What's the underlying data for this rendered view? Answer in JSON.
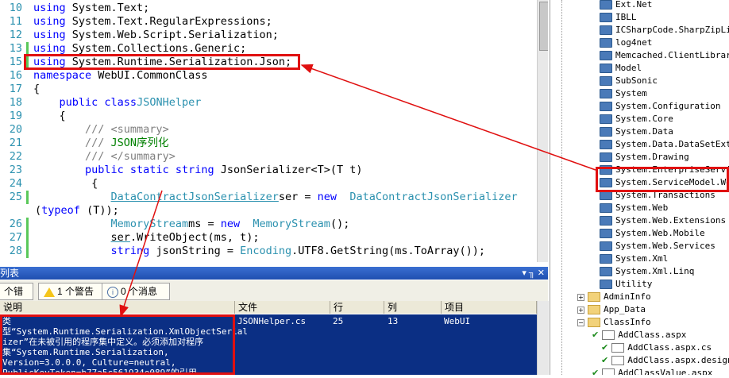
{
  "editor": {
    "lines": [
      {
        "n": "10",
        "parts": [
          [
            "kw",
            "using"
          ],
          [
            "",
            "System.Text;"
          ]
        ]
      },
      {
        "n": "11",
        "parts": [
          [
            "kw",
            "using"
          ],
          [
            "",
            "System.Text.RegularExpressions;"
          ]
        ]
      },
      {
        "n": "12",
        "parts": [
          [
            "kw",
            "using"
          ],
          [
            "",
            "System.Web.Script.Serialization;"
          ]
        ]
      },
      {
        "n": "13",
        "parts": [
          [
            "kw",
            "using"
          ],
          [
            "",
            "System.Collections.Generic;"
          ]
        ]
      },
      {
        "n": "15",
        "parts": [
          [
            "kw",
            "using"
          ],
          [
            "",
            "System.Runtime.Serialization.Json;"
          ]
        ]
      },
      {
        "n": "16",
        "parts": [
          [
            "kw",
            "namespace"
          ],
          [
            "",
            "WebUI.CommonClass"
          ]
        ]
      },
      {
        "n": "17",
        "parts": [
          [
            "",
            "{"
          ]
        ]
      },
      {
        "n": "18",
        "parts": [
          [
            "",
            "    "
          ],
          [
            "kw",
            "public class"
          ],
          [
            "",
            ""
          ],
          [
            "ty",
            "JSONHelper"
          ]
        ]
      },
      {
        "n": "19",
        "parts": [
          [
            "",
            "    {"
          ]
        ]
      },
      {
        "n": "20",
        "parts": [
          [
            "",
            "        "
          ],
          [
            "cm",
            "/// <summary>"
          ]
        ]
      },
      {
        "n": "21",
        "parts": [
          [
            "",
            "        "
          ],
          [
            "cm",
            "///"
          ],
          [
            "cg",
            " JSON序列化"
          ]
        ]
      },
      {
        "n": "22",
        "parts": [
          [
            "",
            "        "
          ],
          [
            "cm",
            "/// </summary>"
          ]
        ]
      },
      {
        "n": "23",
        "parts": [
          [
            "",
            "        "
          ],
          [
            "kw",
            "public static string"
          ],
          [
            "",
            "JsonSerializer<T>(T t)"
          ]
        ]
      },
      {
        "n": "24",
        "parts": [
          [
            "",
            "         {"
          ]
        ]
      },
      {
        "n": "25",
        "parts": [
          [
            "",
            "            "
          ],
          [
            "tyu",
            "DataContractJsonSerializer"
          ],
          [
            "",
            "ser = "
          ],
          [
            "kw",
            "new"
          ],
          [
            "ty",
            " DataContractJsonSerializer"
          ]
        ]
      },
      {
        "n": "",
        "parts": [
          [
            "",
            "("
          ],
          [
            "kw",
            "typeof"
          ],
          [
            "",
            "(T));"
          ]
        ]
      },
      {
        "n": "26",
        "parts": [
          [
            "",
            "            "
          ],
          [
            "ty",
            "MemoryStream"
          ],
          [
            "",
            "ms = "
          ],
          [
            "kw",
            "new"
          ],
          [
            "ty",
            " MemoryStream"
          ],
          [
            "",
            "();"
          ]
        ]
      },
      {
        "n": "27",
        "parts": [
          [
            "",
            "            "
          ],
          [
            "u",
            "ser"
          ],
          [
            "",
            ".WriteObject(ms, t);"
          ]
        ]
      },
      {
        "n": "28",
        "parts": [
          [
            "",
            "            "
          ],
          [
            "kw",
            "string"
          ],
          [
            "",
            "jsonString = "
          ],
          [
            "ty",
            "Encoding"
          ],
          [
            "",
            ".UTF8.GetString(ms.ToArray());"
          ]
        ]
      }
    ]
  },
  "solution_explorer": {
    "items": [
      {
        "label": "Ext.Net",
        "icon": "reference-icon"
      },
      {
        "label": "IBLL",
        "icon": "reference-icon"
      },
      {
        "label": "ICSharpCode.SharpZipLib",
        "icon": "reference-icon"
      },
      {
        "label": "log4net",
        "icon": "reference-icon"
      },
      {
        "label": "Memcached.ClientLibrary",
        "icon": "reference-icon"
      },
      {
        "label": "Model",
        "icon": "reference-icon"
      },
      {
        "label": "SubSonic",
        "icon": "reference-icon"
      },
      {
        "label": "System",
        "icon": "reference-icon"
      },
      {
        "label": "System.Configuration",
        "icon": "reference-icon"
      },
      {
        "label": "System.Core",
        "icon": "reference-icon"
      },
      {
        "label": "System.Data",
        "icon": "reference-icon"
      },
      {
        "label": "System.Data.DataSetExtensions",
        "icon": "reference-icon"
      },
      {
        "label": "System.Drawing",
        "icon": "reference-icon"
      },
      {
        "label": "System.EnterpriseServices",
        "icon": "reference-icon"
      },
      {
        "label": "System.ServiceModel.Web",
        "icon": "reference-icon"
      },
      {
        "label": "System.Transactions",
        "icon": "reference-icon"
      },
      {
        "label": "System.Web",
        "icon": "reference-icon"
      },
      {
        "label": "System.Web.Extensions",
        "icon": "reference-icon"
      },
      {
        "label": "System.Web.Mobile",
        "icon": "reference-icon"
      },
      {
        "label": "System.Web.Services",
        "icon": "reference-icon"
      },
      {
        "label": "System.Xml",
        "icon": "reference-icon"
      },
      {
        "label": "System.Xml.Linq",
        "icon": "reference-icon"
      },
      {
        "label": "Utility",
        "icon": "reference-icon"
      },
      {
        "label": "AdminInfo",
        "icon": "folder-icon"
      },
      {
        "label": "App_Data",
        "icon": "folder-icon"
      },
      {
        "label": "ClassInfo",
        "icon": "folder-icon"
      },
      {
        "label": "AddClass.aspx",
        "icon": "file-icon"
      },
      {
        "label": "AddClass.aspx.cs",
        "icon": "file-icon"
      },
      {
        "label": "AddClass.aspx.designer.cs",
        "icon": "file-icon"
      },
      {
        "label": "AddClassValue.aspx",
        "icon": "file-icon"
      }
    ]
  },
  "error_list": {
    "title": "列表",
    "tabs": {
      "errors": "个错误",
      "warnings": "1 个警告",
      "messages": "0 个消息"
    },
    "columns": [
      "说明",
      "文件",
      "行",
      "列",
      "项目"
    ],
    "row": {
      "description": "类\n型“System.Runtime.Serialization.XmlObjectSerial\nizer”在未被引用的程序集中定义。必须添加对程序\n集“System.Runtime.Serialization,\nVersion=3.0.0.0, Culture=neutral,\nPublicKeyToken=b77a5c561934e089”的引用。",
      "file": "JSONHelper.cs",
      "line": "25",
      "column": "13",
      "project": "WebUI"
    }
  }
}
